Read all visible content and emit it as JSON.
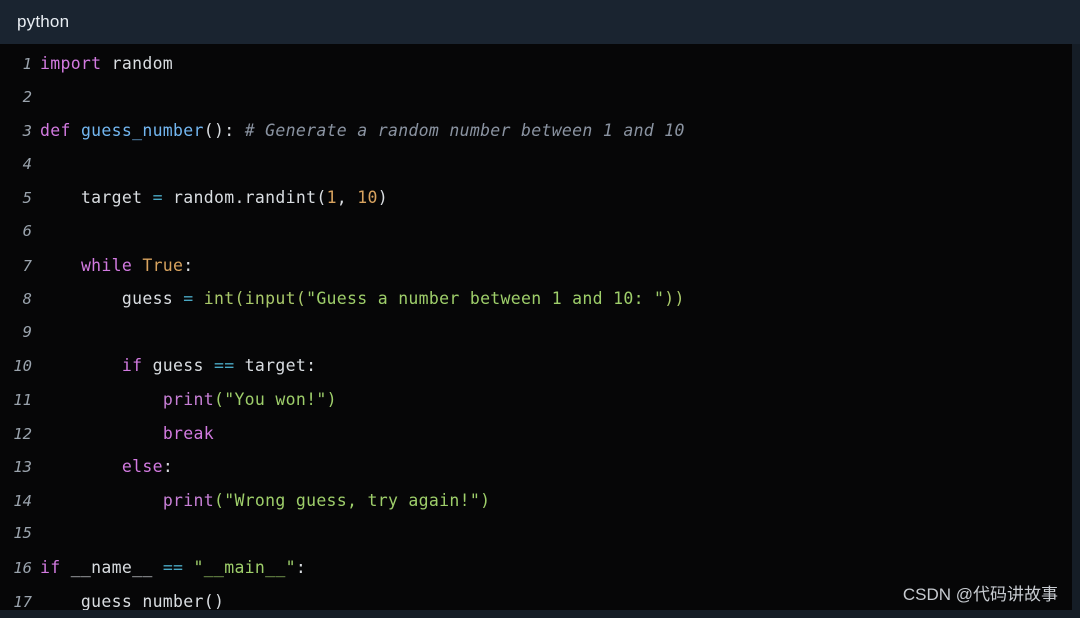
{
  "header": {
    "language_label": "python"
  },
  "code": {
    "language": "python",
    "first_line_number": 1,
    "last_line_number": 17,
    "plain_text": "import random\n\ndef guess_number(): # Generate a random number between 1 and 10\n\n    target = random.randint(1, 10)\n\n    while True:\n        guess = int(input(\"Guess a number between 1 and 10: \"))\n\n        if guess == target:\n            print(\"You won!\")\n            break\n        else:\n            print(\"Wrong guess, try again!\")\n\nif __name__ == \"__main__\":\n    guess_number()",
    "lines": [
      {
        "number": "1",
        "text": "import random",
        "tokens": [
          {
            "t": "import",
            "c": "tok-kw"
          },
          {
            "t": " random",
            "c": "tok-plain"
          }
        ]
      },
      {
        "number": "2",
        "text": "",
        "tokens": []
      },
      {
        "number": "3",
        "text": "def guess_number(): # Generate a random number between 1 and 10",
        "tokens": [
          {
            "t": "def",
            "c": "tok-kw"
          },
          {
            "t": " ",
            "c": "tok-plain"
          },
          {
            "t": "guess_number",
            "c": "tok-fn"
          },
          {
            "t": "(): ",
            "c": "tok-punc"
          },
          {
            "t": "# Generate a random number between 1 and 10",
            "c": "tok-com"
          }
        ]
      },
      {
        "number": "4",
        "text": "",
        "tokens": []
      },
      {
        "number": "5",
        "text": "    target = random.randint(1, 10)",
        "tokens": [
          {
            "t": "    target ",
            "c": "tok-plain"
          },
          {
            "t": "=",
            "c": "tok-op"
          },
          {
            "t": " random.randint(",
            "c": "tok-plain"
          },
          {
            "t": "1",
            "c": "tok-num"
          },
          {
            "t": ", ",
            "c": "tok-punc"
          },
          {
            "t": "10",
            "c": "tok-num"
          },
          {
            "t": ")",
            "c": "tok-punc"
          }
        ]
      },
      {
        "number": "6",
        "text": "",
        "tokens": []
      },
      {
        "number": "7",
        "text": "    while True:",
        "tokens": [
          {
            "t": "    ",
            "c": "tok-plain"
          },
          {
            "t": "while",
            "c": "tok-kw"
          },
          {
            "t": " ",
            "c": "tok-plain"
          },
          {
            "t": "True",
            "c": "tok-cnst"
          },
          {
            "t": ":",
            "c": "tok-punc"
          }
        ]
      },
      {
        "number": "8",
        "text": "        guess = int(input(\"Guess a number between 1 and 10: \"))",
        "tokens": [
          {
            "t": "        guess ",
            "c": "tok-plain"
          },
          {
            "t": "=",
            "c": "tok-op"
          },
          {
            "t": " ",
            "c": "tok-plain"
          },
          {
            "t": "int",
            "c": "tok-bi"
          },
          {
            "t": "(",
            "c": "tok-bi"
          },
          {
            "t": "input",
            "c": "tok-bi"
          },
          {
            "t": "(",
            "c": "tok-bi"
          },
          {
            "t": "\"Guess a number between 1 and 10: \"",
            "c": "tok-str"
          },
          {
            "t": "))",
            "c": "tok-bi"
          }
        ]
      },
      {
        "number": "9",
        "text": "",
        "tokens": []
      },
      {
        "number": "10",
        "text": "        if guess == target:",
        "tokens": [
          {
            "t": "        ",
            "c": "tok-plain"
          },
          {
            "t": "if",
            "c": "tok-kw"
          },
          {
            "t": " guess ",
            "c": "tok-plain"
          },
          {
            "t": "==",
            "c": "tok-op"
          },
          {
            "t": " target:",
            "c": "tok-plain"
          }
        ]
      },
      {
        "number": "11",
        "text": "            print(\"You won!\")",
        "tokens": [
          {
            "t": "            ",
            "c": "tok-plain"
          },
          {
            "t": "print",
            "c": "tok-call"
          },
          {
            "t": "(",
            "c": "tok-str"
          },
          {
            "t": "\"You won!\"",
            "c": "tok-str"
          },
          {
            "t": ")",
            "c": "tok-str"
          }
        ]
      },
      {
        "number": "12",
        "text": "            break",
        "tokens": [
          {
            "t": "            ",
            "c": "tok-plain"
          },
          {
            "t": "break",
            "c": "tok-kw"
          }
        ]
      },
      {
        "number": "13",
        "text": "        else:",
        "tokens": [
          {
            "t": "        ",
            "c": "tok-plain"
          },
          {
            "t": "else",
            "c": "tok-kw"
          },
          {
            "t": ":",
            "c": "tok-punc"
          }
        ]
      },
      {
        "number": "14",
        "text": "            print(\"Wrong guess, try again!\")",
        "tokens": [
          {
            "t": "            ",
            "c": "tok-plain"
          },
          {
            "t": "print",
            "c": "tok-call"
          },
          {
            "t": "(",
            "c": "tok-str"
          },
          {
            "t": "\"Wrong guess, try again!\"",
            "c": "tok-str"
          },
          {
            "t": ")",
            "c": "tok-str"
          }
        ]
      },
      {
        "number": "15",
        "text": "",
        "tokens": []
      },
      {
        "number": "16",
        "text": "if __name__ == \"__main__\":",
        "tokens": [
          {
            "t": "if",
            "c": "tok-kw"
          },
          {
            "t": " __name__ ",
            "c": "tok-plain"
          },
          {
            "t": "==",
            "c": "tok-op"
          },
          {
            "t": " ",
            "c": "tok-plain"
          },
          {
            "t": "\"__main__\"",
            "c": "tok-str"
          },
          {
            "t": ":",
            "c": "tok-punc"
          }
        ]
      },
      {
        "number": "17",
        "text": "    guess_number()",
        "tokens": [
          {
            "t": "    guess_number()",
            "c": "tok-plain"
          }
        ]
      }
    ]
  },
  "watermark": {
    "text": "CSDN @代码讲故事"
  },
  "colors": {
    "header_bg": "#1a2430",
    "code_bg": "#060607",
    "page_bg": "#151d26",
    "keyword": "#d27ae0",
    "function": "#72b6f0",
    "builtin": "#a9c96a",
    "string": "#9ece6a",
    "number": "#d8a35f",
    "operator": "#4aa8c4",
    "call": "#c77fd6",
    "comment": "#8a93a1",
    "plain_text": "#d9dde1",
    "line_number": "#9aa3ad"
  }
}
